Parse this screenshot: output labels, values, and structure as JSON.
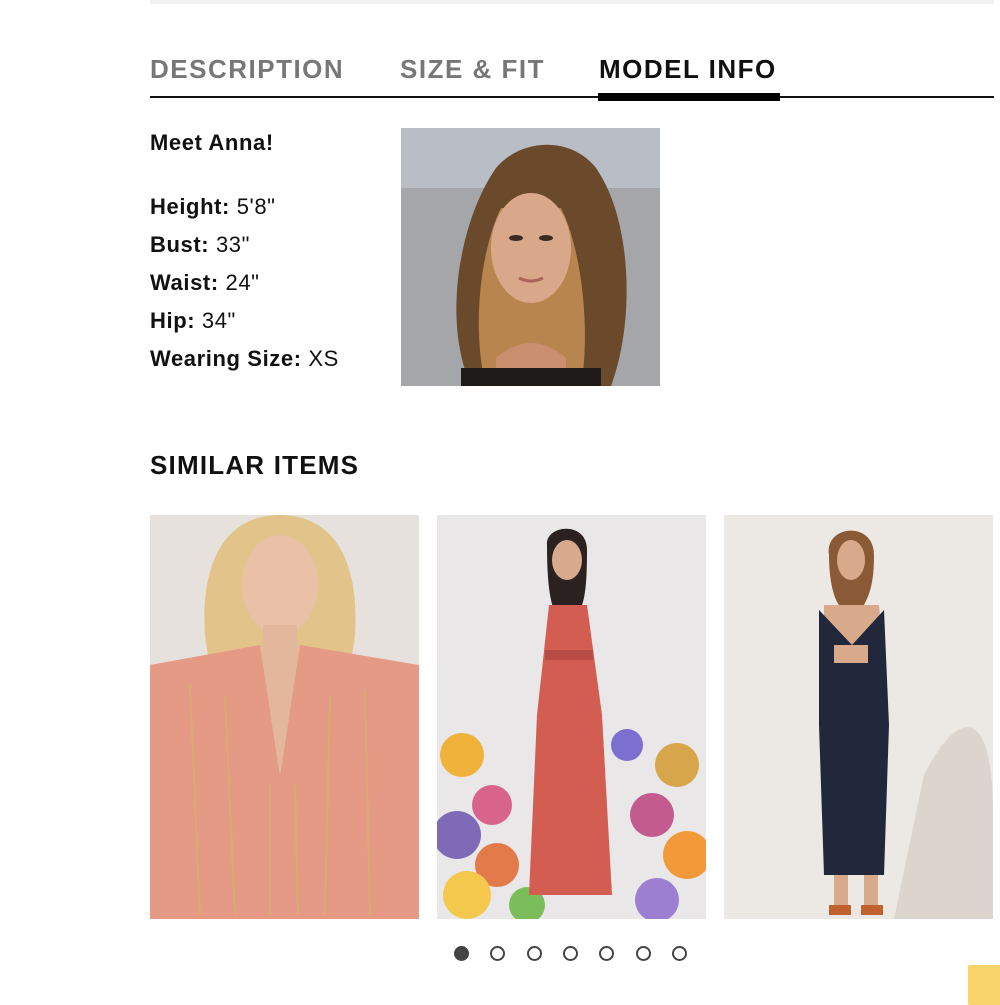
{
  "tabs": [
    {
      "label": "DESCRIPTION",
      "active": false
    },
    {
      "label": "SIZE & FIT",
      "active": false
    },
    {
      "label": "MODEL INFO",
      "active": true
    }
  ],
  "model_info": {
    "greeting": "Meet Anna!",
    "stats": [
      {
        "key": "Height:",
        "value": "5'8\""
      },
      {
        "key": "Bust:",
        "value": "33\""
      },
      {
        "key": "Waist:",
        "value": "24\""
      },
      {
        "key": "Hip:",
        "value": "34\""
      },
      {
        "key": "Wearing Size:",
        "value": "XS"
      }
    ]
  },
  "similar_items": {
    "title": "SIMILAR ITEMS",
    "items": [
      {
        "description": "blush pink embellished v-neck maxi dress"
      },
      {
        "description": "rust red maxi dress with floral backdrop"
      },
      {
        "description": "navy cutout maxi dress"
      }
    ]
  },
  "carousel": {
    "pages": 7,
    "current": 1
  },
  "colors": {
    "accent": "#000000",
    "tab_inactive": "#777777",
    "badge": "#f7d36a"
  }
}
